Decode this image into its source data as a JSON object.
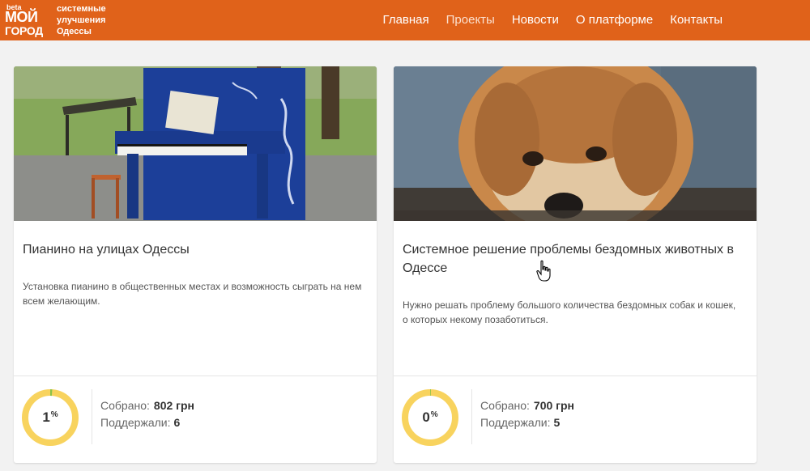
{
  "header": {
    "logo": {
      "beta": "beta",
      "line1": "МОЙ",
      "line2": "ГОРОД",
      "tagline": [
        "системные",
        "улучшения",
        "Одессы"
      ]
    },
    "nav": [
      {
        "label": "Главная",
        "active": false
      },
      {
        "label": "Проекты",
        "active": true
      },
      {
        "label": "Новости",
        "active": false
      },
      {
        "label": "О платформе",
        "active": false
      },
      {
        "label": "Контакты",
        "active": false
      }
    ]
  },
  "colors": {
    "header_bg": "#e0621a",
    "progress_track": "#f8d35e",
    "progress_fill": "#8bc34a"
  },
  "projects": [
    {
      "image": "piano-photo",
      "title": "Пианино на улицах Одессы",
      "description": "Установка пианино в общественных местах и возможность сыграть на нем всем желающим.",
      "percent": "1",
      "percent_sign": "%",
      "progress": 0.01,
      "raised_label": "Собрано:",
      "raised_value": "802 грн",
      "supporters_label": "Поддержали:",
      "supporters_value": "6"
    },
    {
      "image": "dog-photo",
      "title": "Системное решение проблемы бездомных животных в Одессе",
      "description": "Нужно решать проблему большого количества бездомных собак и кошек, о которых некому позаботиться.",
      "percent": "0",
      "percent_sign": "%",
      "progress": 0.0,
      "raised_label": "Собрано:",
      "raised_value": "700 грн",
      "supporters_label": "Поддержали:",
      "supporters_value": "5"
    }
  ]
}
